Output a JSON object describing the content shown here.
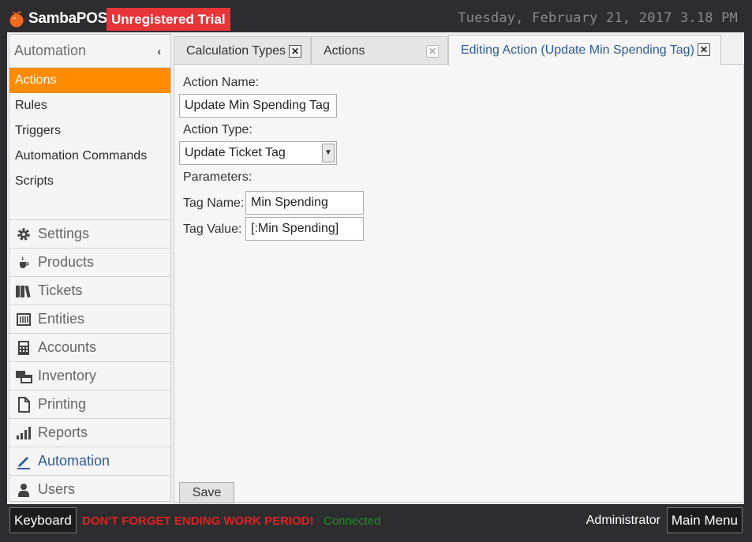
{
  "header": {
    "brand": "SambaPOS",
    "trial_badge": "Unregistered Trial",
    "datetime": "Tuesday, February 21, 2017 3.18 PM"
  },
  "sidebar": {
    "section_title": "Automation",
    "sub_items": [
      {
        "label": "Actions",
        "active": true
      },
      {
        "label": "Rules"
      },
      {
        "label": "Triggers"
      },
      {
        "label": "Automation Commands"
      },
      {
        "label": "Scripts"
      }
    ],
    "nav_items": [
      {
        "label": "Settings",
        "icon": "gear-icon"
      },
      {
        "label": "Products",
        "icon": "coffee-cup-icon"
      },
      {
        "label": "Tickets",
        "icon": "books-icon"
      },
      {
        "label": "Entities",
        "icon": "grid-icon"
      },
      {
        "label": "Accounts",
        "icon": "calculator-icon"
      },
      {
        "label": "Inventory",
        "icon": "windows-icon"
      },
      {
        "label": "Printing",
        "icon": "document-icon"
      },
      {
        "label": "Reports",
        "icon": "bar-chart-icon"
      },
      {
        "label": "Automation",
        "icon": "pencil-icon",
        "active": true
      },
      {
        "label": "Users",
        "icon": "user-icon"
      }
    ]
  },
  "tabs": [
    {
      "label": "Calculation Types"
    },
    {
      "label": "Actions"
    },
    {
      "label": "Editing Action (Update Min Spending Tag)",
      "active": true
    }
  ],
  "form": {
    "action_name_label": "Action Name:",
    "action_name_value": "Update Min Spending Tag",
    "action_type_label": "Action Type:",
    "action_type_value": "Update Ticket Tag",
    "parameters_label": "Parameters:",
    "tag_name_label": "Tag Name:",
    "tag_name_value": "Min Spending",
    "tag_value_label": "Tag Value:",
    "tag_value_value": "[:Min Spending]",
    "save_label": "Save"
  },
  "footer": {
    "keyboard_label": "Keyboard",
    "warning": "DON'T FORGET ENDING WORK PERIOD!",
    "status": "Connected",
    "user": "Administrator",
    "main_menu_label": "Main Menu"
  },
  "colors": {
    "accent_orange": "#ff8c00",
    "trial_red": "#e8353a",
    "link_blue": "#2f5b96",
    "warning_red": "#e02020",
    "connected_green": "#1f8f1f"
  }
}
